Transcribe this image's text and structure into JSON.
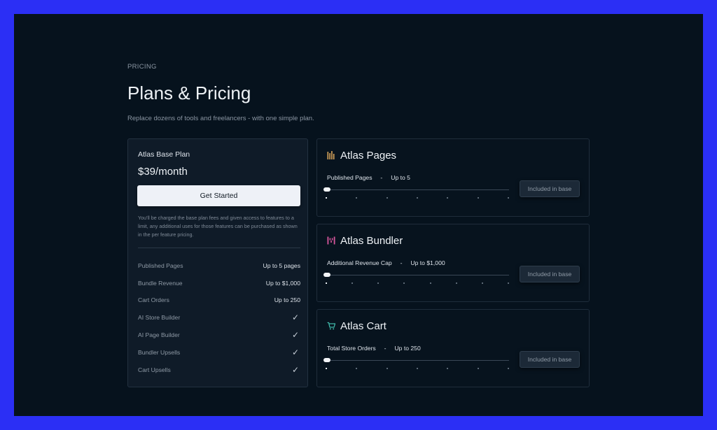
{
  "header": {
    "eyebrow": "PRICING",
    "title": "Plans & Pricing",
    "subtitle": "Replace dozens of tools and freelancers - with one simple plan."
  },
  "base_plan": {
    "name": "Atlas Base Plan",
    "price": "$39/month",
    "cta_label": "Get Started",
    "note": "You'll be charged the base plan fees and given access to features to a limit, any additional uses for those features can be purchased as shown in the per feature pricing.",
    "features": [
      {
        "label": "Published Pages",
        "value": "Up to 5 pages"
      },
      {
        "label": "Bundle Revenue",
        "value": "Up to $1,000"
      },
      {
        "label": "Cart Orders",
        "value": "Up to 250"
      },
      {
        "label": "AI Store Builder",
        "value": "✓"
      },
      {
        "label": "AI Page Builder",
        "value": "✓"
      },
      {
        "label": "Bundler Upsells",
        "value": "✓"
      },
      {
        "label": "Cart Upsells",
        "value": "✓"
      }
    ]
  },
  "feature_cards": [
    {
      "name": "Atlas Pages",
      "metric": "Published Pages     -     Up to 5",
      "badge": "Included in base",
      "icon": "pages-bars-icon",
      "icon_color": "#d9a45a",
      "slider_level": 0,
      "ticks": 7
    },
    {
      "name": "Atlas Bundler",
      "metric": "Additional Revenue Cap     -     Up to $1,000",
      "badge": "Included in base",
      "icon": "bundler-icon",
      "icon_color": "#d7569c",
      "slider_level": 0,
      "ticks": 8
    },
    {
      "name": "Atlas Cart",
      "metric": "Total Store Orders     -     Up to 250",
      "badge": "Included in base",
      "icon": "cart-icon",
      "icon_color": "#3fb6a8",
      "slider_level": 0,
      "ticks": 7
    }
  ],
  "colors": {
    "frame_border": "#2b2ff5",
    "background": "#06121d",
    "card": "#0f1b28"
  }
}
